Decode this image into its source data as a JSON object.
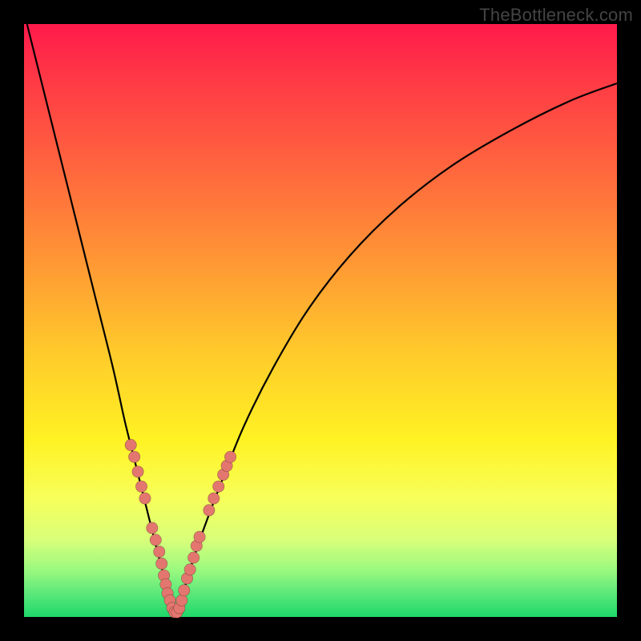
{
  "watermark": "TheBottleneck.com",
  "colors": {
    "frame": "#000000",
    "curve": "#000000",
    "markers": "#e3766e",
    "gradient_top": "#ff1a4b",
    "gradient_bottom": "#1fd86a"
  },
  "chart_data": {
    "type": "line",
    "title": "",
    "xlabel": "",
    "ylabel": "",
    "xlim": [
      0,
      100
    ],
    "ylim": [
      0,
      100
    ],
    "series": [
      {
        "name": "left-branch",
        "x": [
          0.5,
          4,
          8,
          12,
          15,
          17,
          18.5,
          20,
          21.5,
          22.5,
          23.3,
          24.0,
          24.7,
          25.5
        ],
        "y": [
          100,
          86,
          70,
          54,
          42,
          33,
          27,
          21,
          15,
          11,
          8,
          5,
          2.5,
          0.5
        ]
      },
      {
        "name": "right-branch",
        "x": [
          25.5,
          26.5,
          28,
          30,
          33,
          37,
          42,
          48,
          55,
          63,
          72,
          82,
          92,
          100
        ],
        "y": [
          0.5,
          3,
          8,
          14,
          22,
          32,
          42,
          52,
          61,
          69,
          76,
          82,
          87,
          90
        ]
      }
    ],
    "markers": [
      {
        "x": 18.0,
        "y": 29.0
      },
      {
        "x": 18.6,
        "y": 27.0
      },
      {
        "x": 19.2,
        "y": 24.5
      },
      {
        "x": 19.8,
        "y": 22.0
      },
      {
        "x": 20.4,
        "y": 20.0
      },
      {
        "x": 21.6,
        "y": 15.0
      },
      {
        "x": 22.2,
        "y": 13.0
      },
      {
        "x": 22.8,
        "y": 11.0
      },
      {
        "x": 23.2,
        "y": 9.0
      },
      {
        "x": 23.6,
        "y": 7.0
      },
      {
        "x": 23.9,
        "y": 5.5
      },
      {
        "x": 24.2,
        "y": 4.0
      },
      {
        "x": 24.6,
        "y": 2.8
      },
      {
        "x": 25.0,
        "y": 1.5
      },
      {
        "x": 25.4,
        "y": 0.8
      },
      {
        "x": 25.8,
        "y": 0.8
      },
      {
        "x": 26.2,
        "y": 1.5
      },
      {
        "x": 26.6,
        "y": 2.8
      },
      {
        "x": 27.0,
        "y": 4.5
      },
      {
        "x": 27.5,
        "y": 6.5
      },
      {
        "x": 28.0,
        "y": 8.0
      },
      {
        "x": 28.6,
        "y": 10.0
      },
      {
        "x": 29.1,
        "y": 12.0
      },
      {
        "x": 29.6,
        "y": 13.5
      },
      {
        "x": 31.2,
        "y": 18.0
      },
      {
        "x": 32.0,
        "y": 20.0
      },
      {
        "x": 32.8,
        "y": 22.0
      },
      {
        "x": 33.6,
        "y": 24.0
      },
      {
        "x": 34.2,
        "y": 25.5
      },
      {
        "x": 34.8,
        "y": 27.0
      }
    ]
  }
}
